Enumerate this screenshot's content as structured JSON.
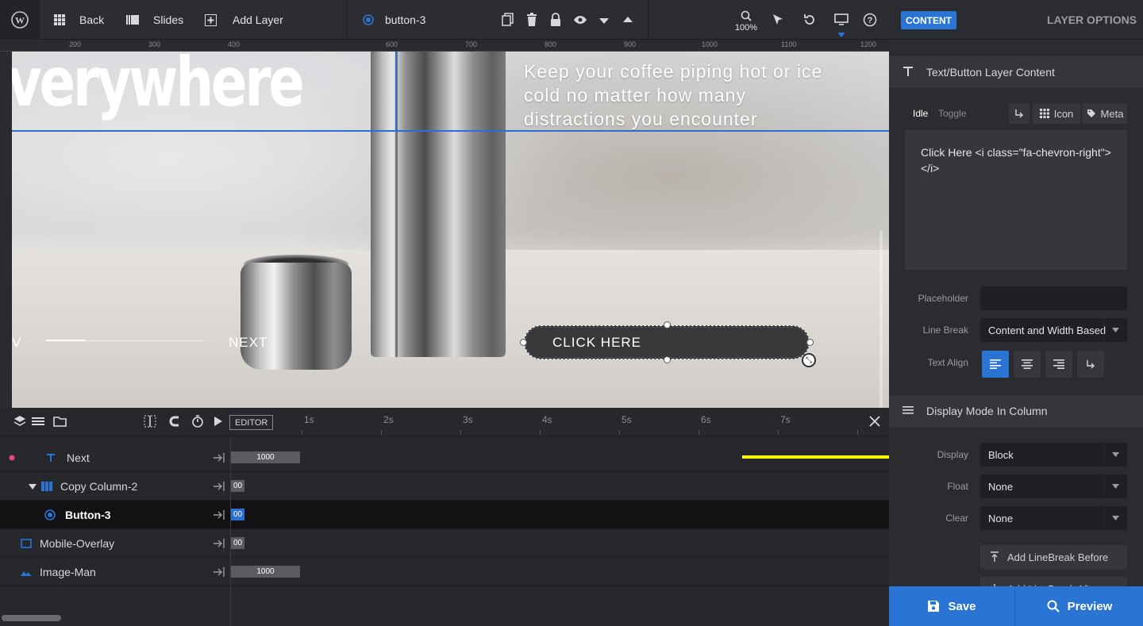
{
  "topbar": {
    "back_label": "Back",
    "slides_label": "Slides",
    "add_layer_label": "Add Layer",
    "selected_layer": "button-3",
    "zoom": "100%"
  },
  "ruler": {
    "labels": [
      "200",
      "300",
      "400",
      "600",
      "700",
      "800",
      "900",
      "1000",
      "1100",
      "1200"
    ]
  },
  "stage": {
    "headline": "verywhere",
    "subtext": "Keep your coffee piping hot or ice cold no matter how many distractions you encounter",
    "prev_label": "V",
    "next_label": "NEXT",
    "button_label": "CLICK HERE"
  },
  "timeline": {
    "editor_label": "EDITOR",
    "ticks": [
      "1s",
      "2s",
      "3s",
      "4s",
      "5s",
      "6s",
      "7s"
    ],
    "rows": [
      {
        "name": "Next",
        "bar": "1000"
      },
      {
        "name": "Copy Column-2",
        "bar": "00"
      },
      {
        "name": "Button-3",
        "bar": "00"
      },
      {
        "name": "Mobile-Overlay",
        "bar": "00"
      },
      {
        "name": "Image-Man",
        "bar": "1000"
      }
    ]
  },
  "panel": {
    "tab_content": "CONTENT",
    "tab_layer_options": "LAYER OPTIONS",
    "section_content": "Text/Button Layer Content",
    "subtab_idle": "Idle",
    "subtab_toggle": "Toggle",
    "icon_btn": "Icon",
    "meta_btn": "Meta",
    "content_text": "Click Here <i class=\"fa-chevron-right\"></i>",
    "placeholder_label": "Placeholder",
    "placeholder_value": "",
    "linebreak_label": "Line Break",
    "linebreak_value": "Content and Width Based",
    "textalign_label": "Text Align",
    "section_display": "Display Mode In Column",
    "display_label": "Display",
    "display_value": "Block",
    "float_label": "Float",
    "float_value": "None",
    "clear_label": "Clear",
    "clear_value": "None",
    "add_linebreak_before": "Add LineBreak Before",
    "add_linebreak_after": "Add LineBreak After",
    "save_label": "Save",
    "preview_label": "Preview"
  },
  "colors": {
    "accent": "#2a74d6",
    "arrow": "#ffff00",
    "record": "#e8457a"
  }
}
